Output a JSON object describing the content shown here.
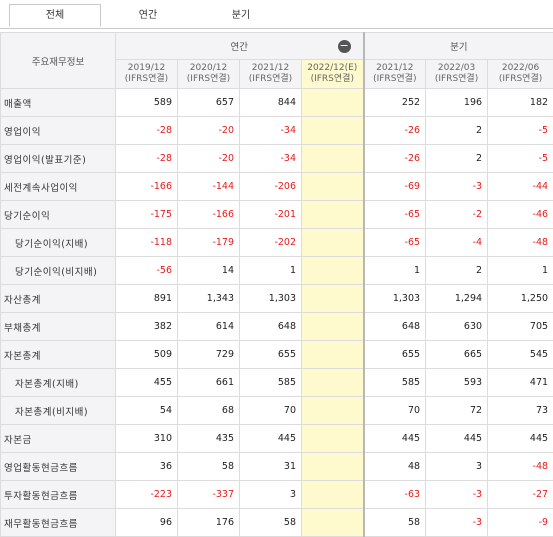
{
  "tabs": [
    {
      "label": "전체"
    },
    {
      "label": "연간"
    },
    {
      "label": "분기"
    }
  ],
  "header": {
    "row_header": "주요재무정보",
    "annual_group": "연간",
    "quarter_group": "분기",
    "columns": [
      {
        "period": "2019/12",
        "basis": "(IFRS연결)"
      },
      {
        "period": "2020/12",
        "basis": "(IFRS연결)"
      },
      {
        "period": "2021/12",
        "basis": "(IFRS연결)"
      },
      {
        "period": "2022/12(E)",
        "basis": "(IFRS연결)"
      },
      {
        "period": "2021/12",
        "basis": "(IFRS연결)"
      },
      {
        "period": "2022/03",
        "basis": "(IFRS연결)"
      },
      {
        "period": "2022/06",
        "basis": "(IFRS연결)"
      }
    ]
  },
  "rows": [
    {
      "label": "매출액",
      "values": [
        "589",
        "657",
        "844",
        "",
        "252",
        "196",
        "182"
      ]
    },
    {
      "label": "영업이익",
      "values": [
        "-28",
        "-20",
        "-34",
        "",
        "-26",
        "2",
        "-5"
      ]
    },
    {
      "label": "영업이익(발표기준)",
      "values": [
        "-28",
        "-20",
        "-34",
        "",
        "-26",
        "2",
        "-5"
      ]
    },
    {
      "label": "세전계속사업이익",
      "values": [
        "-166",
        "-144",
        "-206",
        "",
        "-69",
        "-3",
        "-44"
      ]
    },
    {
      "label": "당기순이익",
      "values": [
        "-175",
        "-166",
        "-201",
        "",
        "-65",
        "-2",
        "-46"
      ]
    },
    {
      "label": "당기순이익(지배)",
      "values": [
        "-118",
        "-179",
        "-202",
        "",
        "-65",
        "-4",
        "-48"
      ]
    },
    {
      "label": "당기순이익(비지배)",
      "values": [
        "-56",
        "14",
        "1",
        "",
        "1",
        "2",
        "1"
      ]
    },
    {
      "label": "자산총계",
      "values": [
        "891",
        "1,343",
        "1,303",
        "",
        "1,303",
        "1,294",
        "1,250"
      ]
    },
    {
      "label": "부채총계",
      "values": [
        "382",
        "614",
        "648",
        "",
        "648",
        "630",
        "705"
      ]
    },
    {
      "label": "자본총계",
      "values": [
        "509",
        "729",
        "655",
        "",
        "655",
        "665",
        "545"
      ]
    },
    {
      "label": "자본총계(지배)",
      "values": [
        "455",
        "661",
        "585",
        "",
        "585",
        "593",
        "471"
      ]
    },
    {
      "label": "자본총계(비지배)",
      "values": [
        "54",
        "68",
        "70",
        "",
        "70",
        "72",
        "73"
      ]
    },
    {
      "label": "자본금",
      "values": [
        "310",
        "435",
        "445",
        "",
        "445",
        "445",
        "445"
      ]
    },
    {
      "label": "영업활동현금흐름",
      "values": [
        "36",
        "58",
        "31",
        "",
        "48",
        "3",
        "-48"
      ]
    },
    {
      "label": "투자활동현금흐름",
      "values": [
        "-223",
        "-337",
        "3",
        "",
        "-63",
        "-3",
        "-27"
      ]
    },
    {
      "label": "재무활동현금흐름",
      "values": [
        "96",
        "176",
        "58",
        "",
        "58",
        "-3",
        "-9"
      ]
    }
  ],
  "collapse_icon": "minus-circle-icon",
  "colors": {
    "negative": "#e51c1c",
    "estimate_bg": "#fffacd",
    "header_bg": "#f4f4f6"
  }
}
